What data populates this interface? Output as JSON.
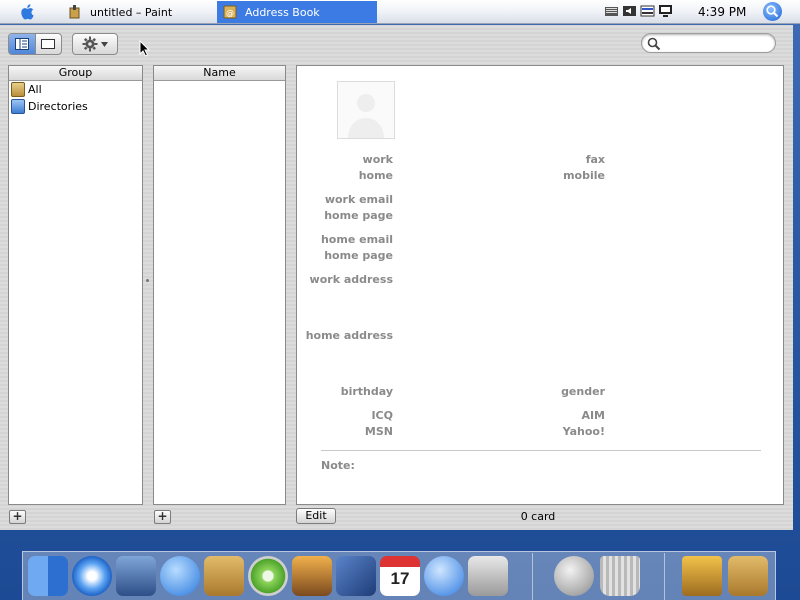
{
  "taskbar": {
    "paint_task": "untitled – Paint",
    "addressbook_task": "Address Book",
    "clock": "4:39 PM"
  },
  "groups_column": {
    "header": "Group",
    "items": [
      {
        "label": "All",
        "icon": "address-book-icon"
      },
      {
        "label": "Directories",
        "icon": "directory-icon"
      }
    ]
  },
  "names_column": {
    "header": "Name",
    "items": []
  },
  "card": {
    "labels": {
      "work": "work",
      "home": "home",
      "fax": "fax",
      "mobile": "mobile",
      "work_email": "work email",
      "work_homepage": "home page",
      "home_email": "home email",
      "home_homepage": "home page",
      "work_address": "work address",
      "home_address": "home address",
      "birthday": "birthday",
      "gender": "gender",
      "icq": "ICQ",
      "aim": "AIM",
      "msn": "MSN",
      "yahoo": "Yahoo!",
      "note": "Note:"
    }
  },
  "bottom_bar": {
    "add_group": "+",
    "add_person": "+",
    "edit": "Edit",
    "card_count": "0 card"
  },
  "search": {
    "placeholder": ""
  },
  "colors": {
    "active_task": "#3c7be3",
    "desktop": "#2c5aa3",
    "label_gray": "#8a8a8a"
  },
  "dock": {
    "items": [
      "finder-icon",
      "safari-icon",
      "mail-icon",
      "ichat-icon",
      "address-book-icon",
      "itunes-icon",
      "iphoto-icon",
      "imovie-icon",
      "ical-icon",
      "quicktime-icon",
      "system-preferences-icon",
      "mail-stamp-icon",
      "trash-icon",
      "pencil-cup-icon",
      "address-book-icon"
    ]
  }
}
